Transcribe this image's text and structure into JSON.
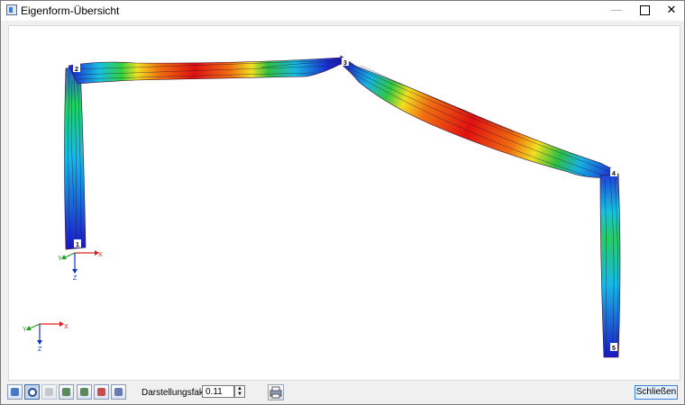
{
  "window": {
    "title": "Eigenform-Übersicht"
  },
  "window_controls": {
    "minimize": "—",
    "close": "✕"
  },
  "view": {
    "nodes": [
      "1",
      "2",
      "3",
      "4",
      "5"
    ],
    "local_axes": {
      "x": "X",
      "y": "Y",
      "z": "Z"
    },
    "global_axes": {
      "x": "X",
      "y": "Y",
      "z": "Z"
    },
    "colors": {
      "axis_x": "#e02020",
      "axis_y": "#20a020",
      "axis_z": "#1530c0"
    }
  },
  "toolbar": {
    "icons": [
      "display-options-icon",
      "zoom-icon",
      "view-icon",
      "view-x-icon",
      "view-y-icon",
      "view-z-icon",
      "isometric-view-icon"
    ],
    "factor_label": "Darstellungsfaktor:",
    "factor_value": "0.11",
    "print_icon": "print-icon",
    "close_label": "Schließen"
  }
}
